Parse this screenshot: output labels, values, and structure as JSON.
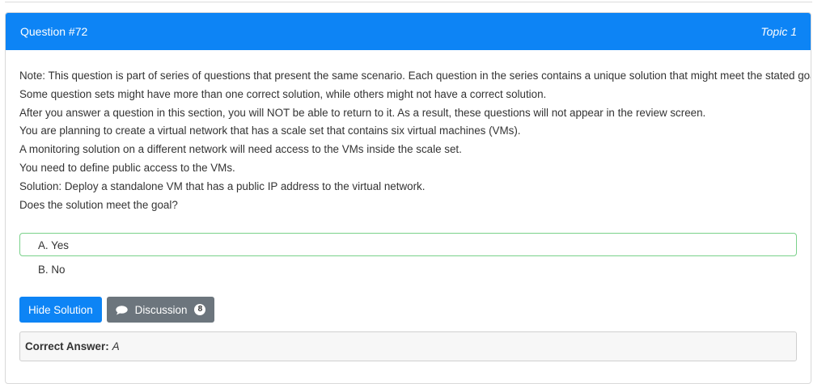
{
  "header": {
    "question_label": "Question #72",
    "topic_label": "Topic 1"
  },
  "question": {
    "lines": [
      "Note: This question is part of series of questions that present the same scenario. Each question in the series contains a unique solution that might meet the stated goals.",
      "Some question sets might have more than one correct solution, while others might not have a correct solution.",
      "After you answer a question in this section, you will NOT be able to return to it. As a result, these questions will not appear in the review screen.",
      "You are planning to create a virtual network that has a scale set that contains six virtual machines (VMs).",
      "A monitoring solution on a different network will need access to the VMs inside the scale set.",
      "You need to define public access to the VMs.",
      "Solution: Deploy a standalone VM that has a public IP address to the virtual network.",
      "Does the solution meet the goal?"
    ]
  },
  "choices": [
    {
      "label": "A. Yes",
      "correct": true
    },
    {
      "label": "B. No",
      "correct": false
    }
  ],
  "buttons": {
    "hide_solution": "Hide Solution",
    "discussion": "Discussion",
    "discussion_count": "8"
  },
  "answer": {
    "label": "Correct Answer:",
    "value": "A"
  },
  "colors": {
    "accent": "#0d84f5",
    "secondary": "#6c757d",
    "correct_border": "#7ad18a"
  },
  "icons": {
    "discussion": "speech-bubble-icon"
  }
}
